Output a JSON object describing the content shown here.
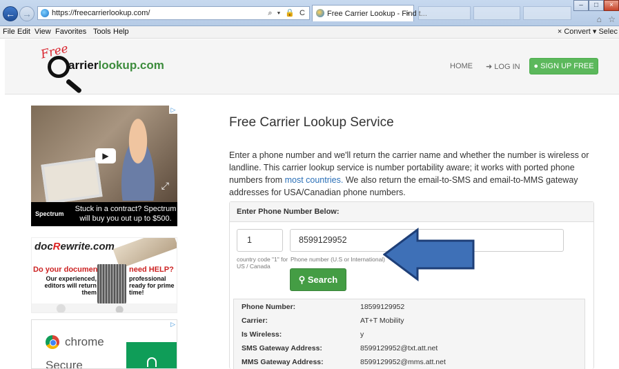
{
  "browser": {
    "url": "https://freecarrierlookup.com/",
    "tab_title": "Free Carrier Lookup - Find t...",
    "tab_close": "×",
    "address_tools": "⌕ ▾ 🔒 C",
    "window_buttons": [
      "–",
      "□",
      "×"
    ],
    "right_icons": "⌂ ☆",
    "menus": [
      "File",
      "Edit",
      "View",
      "Favorites",
      "Tools",
      "Help"
    ],
    "menu_right": "× Convert ▾ Selec"
  },
  "site": {
    "logo_free": "Free",
    "logo_text_main": "arrier",
    "logo_text_accent": "lookup.com",
    "nav_home": "HOME",
    "nav_login": "LOG IN",
    "nav_signup": "SIGN UP FREE"
  },
  "ads": {
    "ad1": {
      "brand": "Spectrum",
      "copy": "Stuck in a contract? Spectrum will buy you out up to $500."
    },
    "ad2": {
      "logo_pre": "doc",
      "logo_r": "R",
      "logo_post": "ewrite.com",
      "left_title": "Do your documents",
      "left_body": "Our experienced, editors will return them",
      "right_title": "need HELP?",
      "right_body": "professional ready for prime time!"
    },
    "ad3": {
      "name": "chrome",
      "secure": "Secure"
    }
  },
  "main": {
    "title": "Free Carrier Lookup Service",
    "intro_part1": "Enter a phone number and we'll return the carrier name and whether the number is wireless or landline. This carrier lookup service is number portability aware; it works with ported phone numbers from ",
    "intro_link": "most countries.",
    "intro_part2": " We also return the email-to-SMS and email-to-MMS gateway addresses for USA/Canadian phone numbers.",
    "panel_heading": "Enter Phone Number Below:",
    "country_code": "1",
    "country_help": "country code \"1\" for US / Canada",
    "phone_value": "8599129952",
    "phone_help": "Phone number (U.S or International)",
    "search_label": "Search"
  },
  "results": [
    {
      "label": "Phone Number:",
      "value": "18599129952"
    },
    {
      "label": "Carrier:",
      "value": "AT+T Mobility"
    },
    {
      "label": "Is Wireless:",
      "value": "y"
    },
    {
      "label": "SMS Gateway Address:",
      "value": "8599129952@txt.att.net"
    },
    {
      "label": "MMS Gateway Address:",
      "value": "8599129952@mms.att.net"
    }
  ],
  "colors": {
    "brand_green": "#5cb85c",
    "search_green": "#449d44",
    "arrow_blue": "#3e70b7",
    "link_blue": "#2a6fb7"
  }
}
